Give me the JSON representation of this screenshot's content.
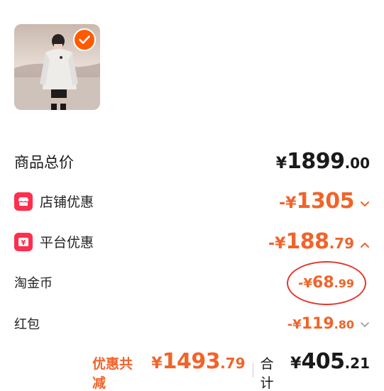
{
  "product": {
    "image": "woman-in-white-puffer-jacket",
    "selected": true
  },
  "rows": [
    {
      "label": "商品总价",
      "prefix": "",
      "yen": "¥",
      "int": "1899",
      "dec": ".00",
      "color": "#1a1a1a",
      "chevron": "none"
    },
    {
      "label": "店铺优惠",
      "prefix": "-",
      "yen": "¥",
      "int": "1305",
      "dec": "",
      "color": "#f0642a",
      "chevron": "down",
      "icon": "shop-icon"
    },
    {
      "label": "平台优惠",
      "prefix": "-",
      "yen": "¥",
      "int": "188",
      "dec": ".79",
      "color": "#f0642a",
      "chevron": "up",
      "icon": "platform-icon"
    },
    {
      "label": "淘金币",
      "prefix": "-",
      "yen": "¥",
      "int": "68",
      "dec": ".99",
      "color": "#f0642a",
      "chevron": "none"
    },
    {
      "label": "红包",
      "prefix": "-",
      "yen": "¥",
      "int": "119",
      "dec": ".80",
      "color": "#f0642a",
      "chevron": "down"
    }
  ],
  "footer": {
    "discount_label": "优惠共减",
    "discount_yen": "¥",
    "discount_int": "1493",
    "discount_dec": ".79",
    "total_label": "合计",
    "total_yen": "¥",
    "total_int": "405",
    "total_dec": ".21"
  },
  "colors": {
    "accent": "#f0642a",
    "brand_red": "#ff2e4d",
    "check_orange": "#ff5a00",
    "ring_red": "#e4382e"
  }
}
